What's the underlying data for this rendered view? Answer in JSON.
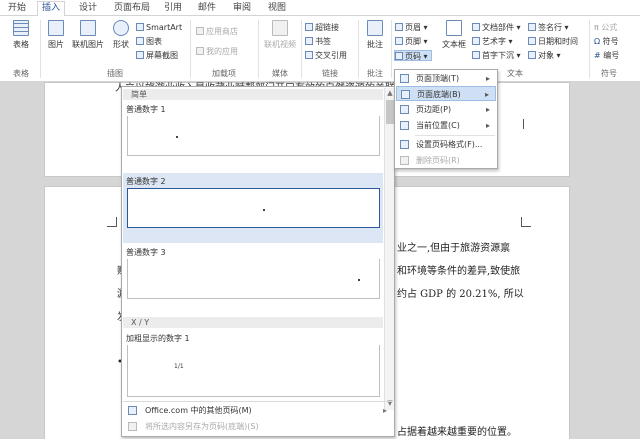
{
  "tabs": [
    "开始",
    "插入",
    "设计",
    "页面布局",
    "引用",
    "邮件",
    "审阅",
    "视图"
  ],
  "active_tab": "插入",
  "ribbon": {
    "table": "表格",
    "picture": "图片",
    "online_picture": "联机图片",
    "shapes": "形状",
    "smartart": "SmartArt",
    "chart": "图表",
    "screenshot": "屏幕截图",
    "app_store": "应用商店",
    "my_apps": "我的应用",
    "online_video": "联机视频",
    "hyperlink": "超链接",
    "bookmark": "书签",
    "cross_reference": "交叉引用",
    "comment": "批注",
    "header": "页眉",
    "footer": "页脚",
    "page_number": "页码",
    "text_box": "文本框",
    "doc_parts": "文档部件",
    "wordart": "艺术字",
    "drop_cap": "首字下沉",
    "signature_line": "签名行",
    "date_time": "日期和时间",
    "object": "对象",
    "equation": "公式",
    "symbol": "符号",
    "number": "编号",
    "groups": {
      "tables": "表格",
      "illustrations": "插图",
      "addins": "加载项",
      "media": "媒体",
      "links": "链接",
      "comments": "批注",
      "text": "文本",
      "symbols": "符号"
    }
  },
  "page_number_menu": {
    "items": [
      {
        "label": "页面顶端(T)",
        "submenu": true
      },
      {
        "label": "页面底端(B)",
        "submenu": true,
        "highlighted": true
      },
      {
        "label": "页边距(P)",
        "submenu": true
      },
      {
        "label": "当前位置(C)",
        "submenu": true
      },
      {
        "label": "设置页码格式(F)...",
        "submenu": false
      },
      {
        "label": "删除页码(R)",
        "submenu": false,
        "disabled": true
      }
    ]
  },
  "gallery": {
    "section_simple": "简单",
    "item1": "普通数字 1",
    "item2": "普通数字 2",
    "item3": "普通数字 3",
    "section_xy": "X / Y",
    "item4": "加粗显示的数字 1",
    "item4_sample": "1/1",
    "more_from_office": "Office.com 中的其他页码(M)",
    "save_selection": "将所选内容另存为页码(底端)(S)",
    "scroll_up": "▲",
    "scroll_down": "▼"
  },
  "document": {
    "line_top": "人立以旅游业收入是收藏业赋帮部门开口有效的自然资源的关联",
    "line1_right": "业之一,但由于旅游资源禀",
    "line2_left": "赋",
    "line2_right": "和环境等条件的差异,致使旅",
    "line3_left": "游",
    "line3_right": "约占 GDP 的 20.21%, 所以",
    "line4_left": "发",
    "line5_left": "•",
    "line_bottom_right": "占据着越来越重要的位置。"
  },
  "colors": {
    "accent": "#2b579a",
    "highlight": "#cfe0f5",
    "gallery_selected": "#dce6f4"
  }
}
